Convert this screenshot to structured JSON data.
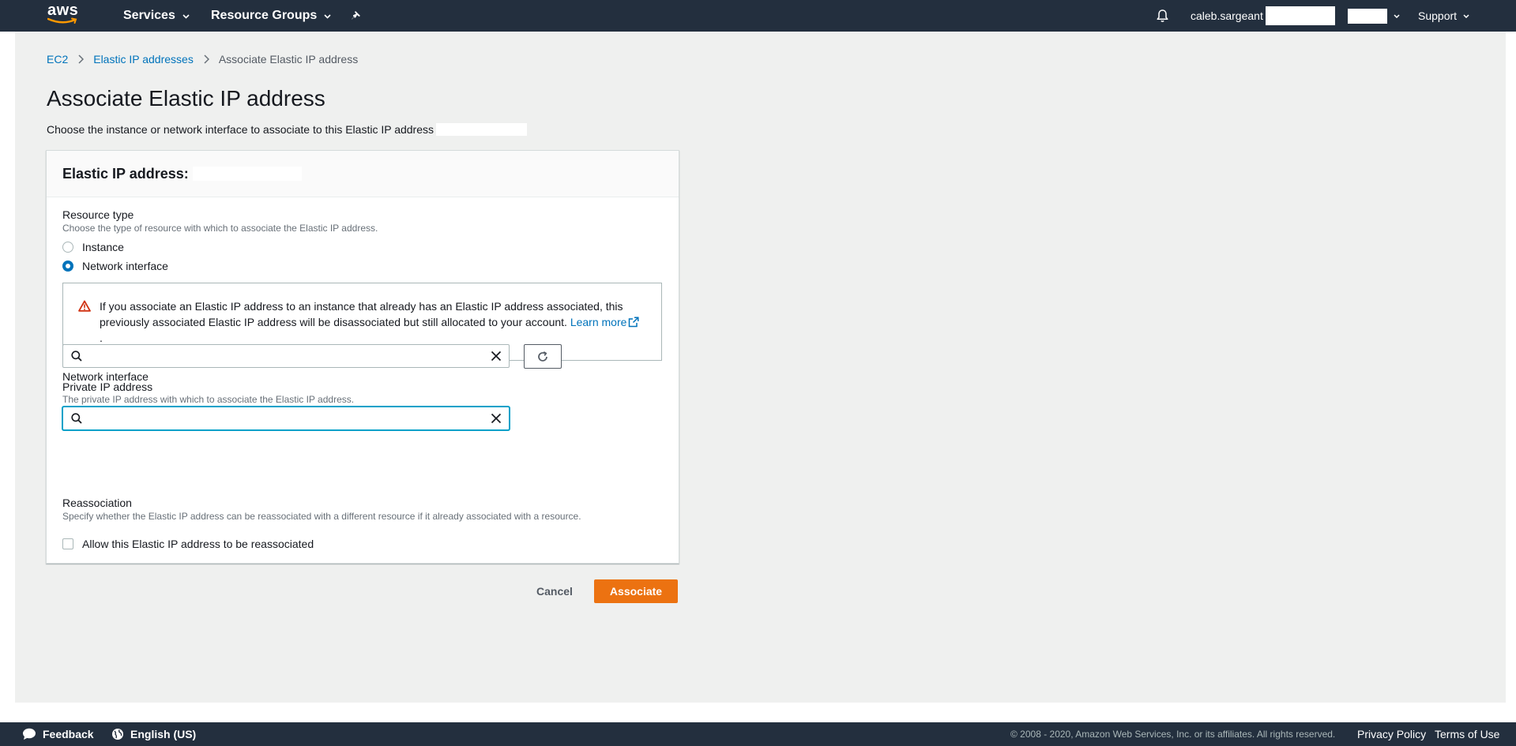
{
  "topnav": {
    "logo_text": "aws",
    "services_label": "Services",
    "resource_groups_label": "Resource Groups",
    "username": "caleb.sargeant",
    "support_label": "Support",
    "icons": [
      "caret-down-icon",
      "pin-icon",
      "bell-icon"
    ]
  },
  "breadcrumb": {
    "items": [
      "EC2",
      "Elastic IP addresses"
    ],
    "current": "Associate Elastic IP address"
  },
  "page": {
    "title": "Associate Elastic IP address",
    "description": "Choose the instance or network interface to associate to this Elastic IP address"
  },
  "card": {
    "header_label": "Elastic IP address:",
    "resource_type": {
      "label": "Resource type",
      "description": "Choose the type of resource with which to associate the Elastic IP address.",
      "options": [
        "Instance",
        "Network interface"
      ],
      "selected": "Network interface"
    },
    "alert": {
      "text": "If you associate an Elastic IP address to an instance that already has an Elastic IP address associated, this previously associated Elastic IP address will be disassociated but still allocated to your account.",
      "link_label": "Learn more",
      "trailing": "."
    },
    "network_interface": {
      "label": "Network interface",
      "value": "",
      "placeholder": ""
    },
    "private_ip": {
      "label": "Private IP address",
      "description": "The private IP address with which to associate the Elastic IP address.",
      "value": "",
      "placeholder": ""
    },
    "reassociation": {
      "label": "Reassociation",
      "description": "Specify whether the Elastic IP address can be reassociated with a different resource if it already associated with a resource.",
      "checkbox_label": "Allow this Elastic IP address to be reassociated",
      "checked": false
    }
  },
  "actions": {
    "cancel_label": "Cancel",
    "associate_label": "Associate"
  },
  "footer": {
    "feedback_label": "Feedback",
    "language_label": "English (US)",
    "copyright": "© 2008 - 2020, Amazon Web Services, Inc. or its affiliates. All rights reserved.",
    "privacy_label": "Privacy Policy",
    "terms_label": "Terms of Use"
  },
  "colors": {
    "nav_bg": "#232f3e",
    "page_bg": "#eff0ef",
    "link": "#0073bb",
    "primary_button": "#ec7211",
    "warning": "#d13212",
    "focus": "#00a1c9"
  }
}
